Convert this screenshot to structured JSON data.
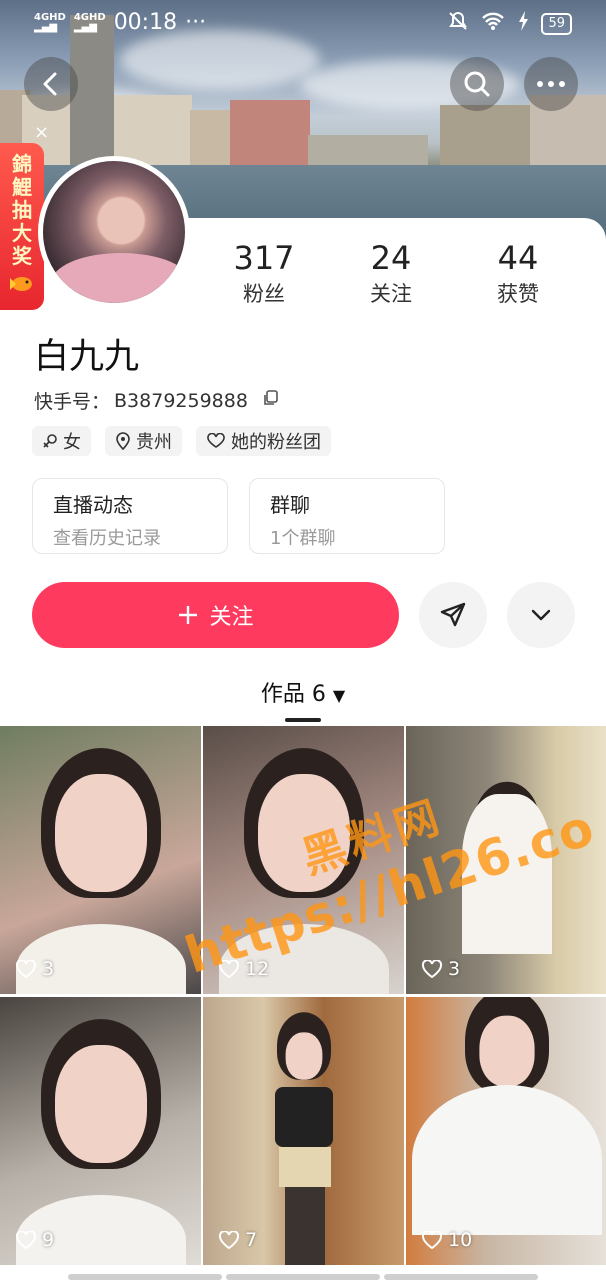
{
  "status_bar": {
    "network_1": "4GHD",
    "network_2": "4GHD",
    "time": "00:18",
    "more": "···",
    "battery": "59"
  },
  "lottery_banner": {
    "label": "錦鯉抽大奖"
  },
  "profile": {
    "stats": [
      {
        "value": "317",
        "label": "粉丝"
      },
      {
        "value": "24",
        "label": "关注"
      },
      {
        "value": "44",
        "label": "获赞"
      }
    ],
    "name": "白九九",
    "kuaishou_id_label": "快手号：",
    "kuaishou_id": "B3879259888",
    "tags": [
      {
        "icon": "female-icon",
        "label": "女"
      },
      {
        "icon": "location-icon",
        "label": "贵州"
      },
      {
        "icon": "fan-group-icon",
        "label": "她的粉丝团"
      }
    ],
    "info_cards": [
      {
        "title": "直播动态",
        "sub": "查看历史记录"
      },
      {
        "title": "群聊",
        "sub": "1个群聊"
      }
    ]
  },
  "actions": {
    "follow_label": "关注",
    "follow_color": "#fe3b5f"
  },
  "works": {
    "label": "作品 6",
    "items": [
      {
        "likes": "3",
        "bg": "#c9a79a"
      },
      {
        "likes": "12",
        "bg": "#a78d84"
      },
      {
        "likes": "3",
        "bg": "#8c8578"
      },
      {
        "likes": "9",
        "bg": "#b7b0a8"
      },
      {
        "likes": "7",
        "bg": "#bca78e"
      },
      {
        "likes": "10",
        "bg": "#c8b6a4"
      }
    ]
  },
  "watermark": {
    "line1": "黑料网",
    "line2": "https://hl26.co"
  }
}
